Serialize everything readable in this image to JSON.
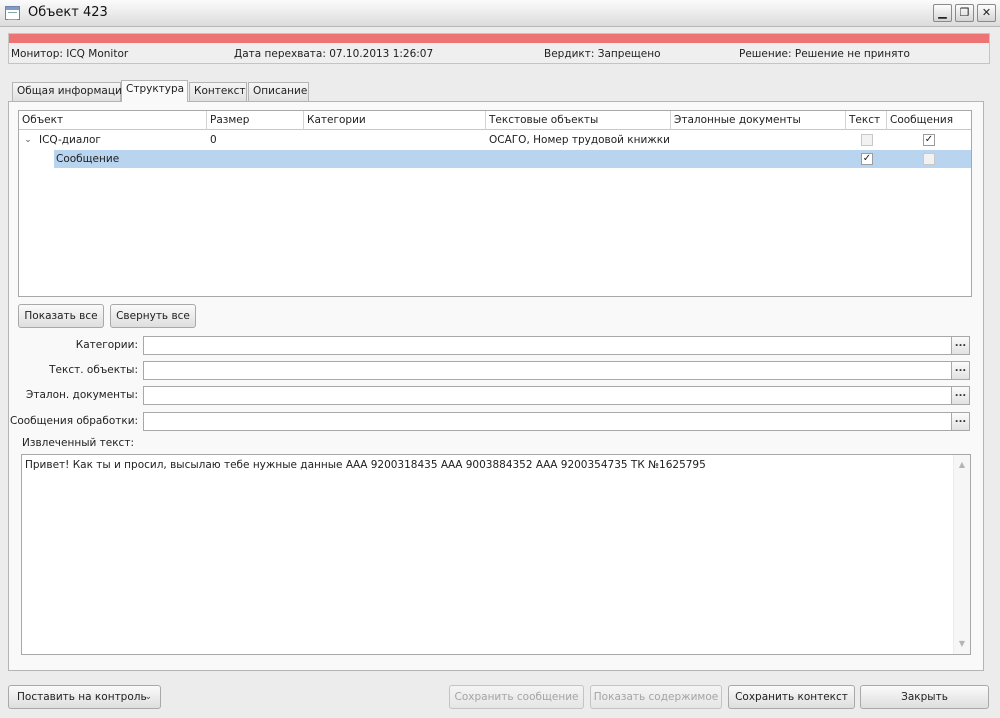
{
  "window": {
    "title": "Объект 423",
    "minimize_glyph": "▁",
    "maximize_glyph": "❐",
    "close_glyph": "✕"
  },
  "status": {
    "monitor": "Монитор: ICQ Monitor",
    "capture_date": "Дата перехвата: 07.10.2013 1:26:07",
    "verdict": "Вердикт: Запрещено",
    "decision": "Решение: Решение не принято",
    "color": "#ee7474"
  },
  "tabs": [
    {
      "label": "Общая информация",
      "active": false
    },
    {
      "label": "Структура",
      "active": true
    },
    {
      "label": "Контекст",
      "active": false
    },
    {
      "label": "Описание",
      "active": false
    }
  ],
  "grid": {
    "columns": [
      "Объект",
      "Размер",
      "Категории",
      "Текстовые объекты",
      "Эталонные документы",
      "Текст",
      "Сообщения"
    ],
    "rows": [
      {
        "expander": "⌄",
        "object": "ICQ-диалог",
        "size": "0",
        "categories": "",
        "text_objects": "ОСАГО, Номер трудовой книжки",
        "reference_docs": "",
        "text_checked": false,
        "text_check_glyph": "",
        "messages_checked": true,
        "messages_check_glyph": "✓"
      },
      {
        "object": "Сообщение",
        "size": "",
        "categories": "",
        "text_objects": "",
        "reference_docs": "",
        "text_checked": true,
        "text_check_glyph": "✓",
        "messages_checked": false,
        "messages_check_glyph": "",
        "selected": true
      }
    ],
    "selection_color": "#b8d4ee"
  },
  "tree_buttons": {
    "show_all": "Показать все",
    "collapse_all": "Свернуть все"
  },
  "fields": {
    "categories": {
      "label": "Категории:",
      "value": ""
    },
    "text_objects": {
      "label": "Текст. объекты:",
      "value": ""
    },
    "reference_docs": {
      "label": "Эталон. документы:",
      "value": ""
    },
    "processing_messages": {
      "label": "Сообщения обработки:",
      "value": ""
    },
    "ellipsis_glyph": "..."
  },
  "extracted": {
    "label": "Извлеченный текст:",
    "text": "Привет! Как ты и просил, высылаю тебе нужные данные ААА 9200318435 ААА 9003884352 ААА 9200354735 ТК №1625795",
    "scroll_up_glyph": "▲",
    "scroll_down_glyph": "▼"
  },
  "footer": {
    "put_on_control": "Поставить на контроль",
    "dropdown_glyph": "⌄",
    "save_message": "Сохранить сообщение",
    "show_content": "Показать содержимое",
    "save_context": "Сохранить контекст",
    "close": "Закрыть"
  }
}
